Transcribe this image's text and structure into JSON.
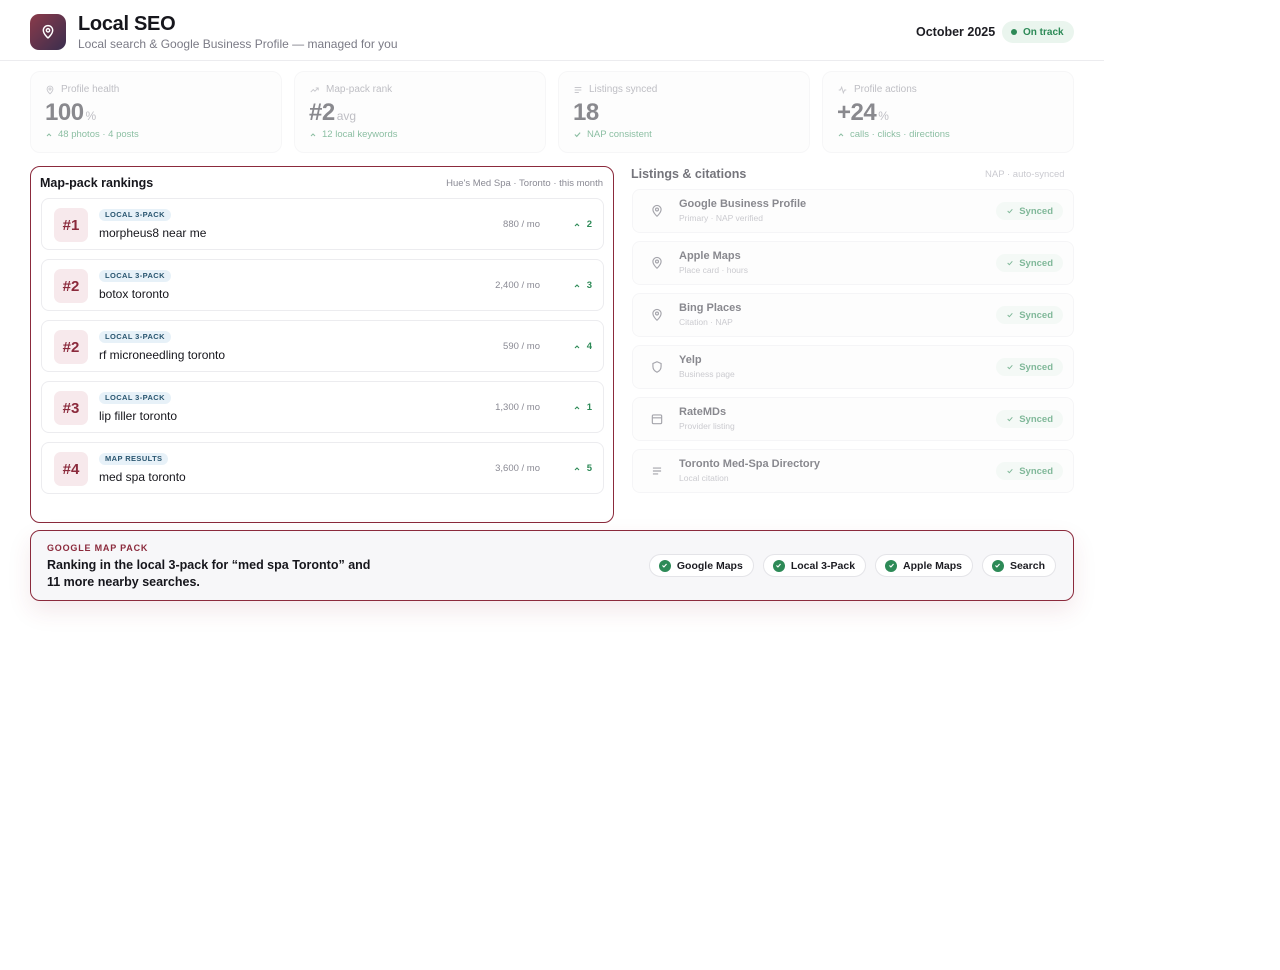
{
  "header": {
    "title": "Local SEO",
    "subtitle": "Local search & Google Business Profile — managed for you",
    "month": "October 2025",
    "status": "On track",
    "logo_icon": "map-pin-icon"
  },
  "kpis": [
    {
      "label": "Profile health",
      "value": "100",
      "unit": "%",
      "foot": "48 photos · 4 posts",
      "icon": "map-pin-icon",
      "foot_icon": "chevron-up-icon"
    },
    {
      "label": "Map-pack rank",
      "value": "#2",
      "unit": "avg",
      "foot": "12 local keywords",
      "icon": "trend-up-icon",
      "foot_icon": "chevron-up-icon"
    },
    {
      "label": "Listings synced",
      "value": "18",
      "unit": "",
      "foot": "NAP consistent",
      "icon": "list-icon",
      "foot_icon": "check-icon"
    },
    {
      "label": "Profile actions",
      "value": "+24",
      "unit": "%",
      "foot": "calls · clicks · directions",
      "icon": "activity-icon",
      "foot_icon": "chevron-up-icon"
    }
  ],
  "rankings": {
    "title": "Map-pack rankings",
    "meta": "Hue's Med Spa · Toronto · this month",
    "rows": [
      {
        "rank": "#1",
        "tag": "LOCAL 3-PACK",
        "keyword": "morpheus8 near me",
        "volume": "880 / mo",
        "delta": "2"
      },
      {
        "rank": "#2",
        "tag": "LOCAL 3-PACK",
        "keyword": "botox toronto",
        "volume": "2,400 / mo",
        "delta": "3"
      },
      {
        "rank": "#2",
        "tag": "LOCAL 3-PACK",
        "keyword": "rf microneedling toronto",
        "volume": "590 / mo",
        "delta": "4"
      },
      {
        "rank": "#3",
        "tag": "LOCAL 3-PACK",
        "keyword": "lip filler toronto",
        "volume": "1,300 / mo",
        "delta": "1"
      },
      {
        "rank": "#4",
        "tag": "MAP RESULTS",
        "keyword": "med spa toronto",
        "volume": "3,600 / mo",
        "delta": "5"
      }
    ]
  },
  "listings": {
    "title": "Listings & citations",
    "meta": "NAP · auto-synced",
    "rows": [
      {
        "name": "Google Business Profile",
        "sub": "Primary · NAP verified",
        "status": "Synced",
        "icon": "map-pin-icon"
      },
      {
        "name": "Apple Maps",
        "sub": "Place card · hours",
        "status": "Synced",
        "icon": "map-pin-icon"
      },
      {
        "name": "Bing Places",
        "sub": "Citation · NAP",
        "status": "Synced",
        "icon": "map-pin-icon"
      },
      {
        "name": "Yelp",
        "sub": "Business page",
        "status": "Synced",
        "icon": "shield-icon"
      },
      {
        "name": "RateMDs",
        "sub": "Provider listing",
        "status": "Synced",
        "icon": "calendar-icon"
      },
      {
        "name": "Toronto Med-Spa Directory",
        "sub": "Local citation",
        "status": "Synced",
        "icon": "lines-icon"
      }
    ]
  },
  "banner": {
    "kicker": "GOOGLE MAP PACK",
    "headline": "Ranking in the local 3-pack for “med spa Toronto” and 11 more nearby searches.",
    "chips": [
      "Google Maps",
      "Local 3-Pack",
      "Apple Maps",
      "Search"
    ]
  },
  "colors": {
    "accent": "#8b2a3c",
    "success": "#2d8a57",
    "tag_bg": "#e7f1f8"
  }
}
